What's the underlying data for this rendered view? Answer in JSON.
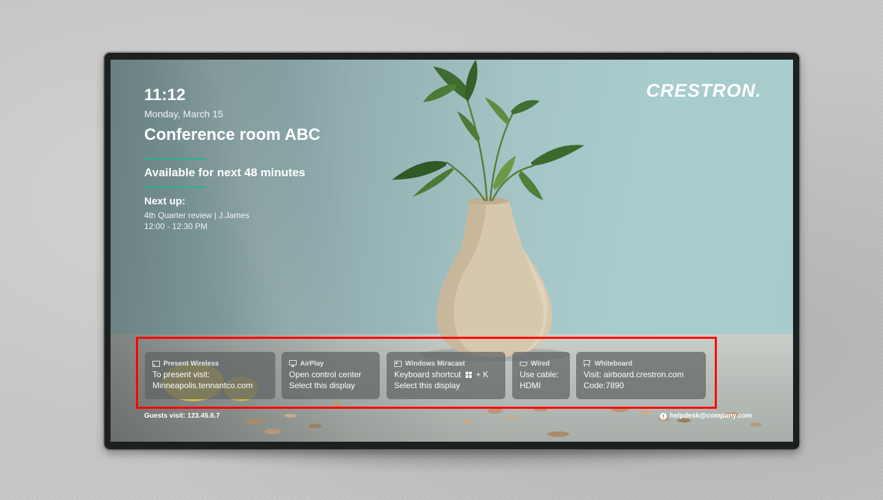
{
  "room_display": {
    "brand": "CRESTRON.",
    "time": "11:12",
    "date": "Monday, March 15",
    "room_name": "Conference room ABC",
    "availability": "Available for next 48 minutes",
    "next_up": {
      "heading": "Next up:",
      "meeting": "4th Quarter review | J.James",
      "time_range": "12:00 - 12:30 PM"
    }
  },
  "share_options": [
    {
      "title": "Present Wireless",
      "icon": "cast-icon",
      "lines": [
        "To present visit:",
        "Minneapolis.tennantco.com"
      ]
    },
    {
      "title": "AirPlay",
      "icon": "airplay-icon",
      "lines": [
        "Open control center",
        "Select this display"
      ]
    },
    {
      "title": "Windows Miracast",
      "icon": "miracast-icon",
      "line1_prefix": "Keyboard shortcut",
      "line1_suffix": "+ K",
      "line2": "Select this display"
    },
    {
      "title": "Wired",
      "icon": "hdmi-icon",
      "lines": [
        "Use cable:",
        "HDMI"
      ]
    },
    {
      "title": "Whiteboard",
      "icon": "whiteboard-icon",
      "lines": [
        "Visit: airboard.crestron.com",
        "Code:7890"
      ]
    }
  ],
  "footer": {
    "guests": "Guests visit:  123.45.6.7",
    "help": "helpdesk@company.com"
  },
  "colors": {
    "accent_rule": "#27b38f",
    "highlight_box": "#ff0000",
    "wall": "#c7c7c5"
  }
}
